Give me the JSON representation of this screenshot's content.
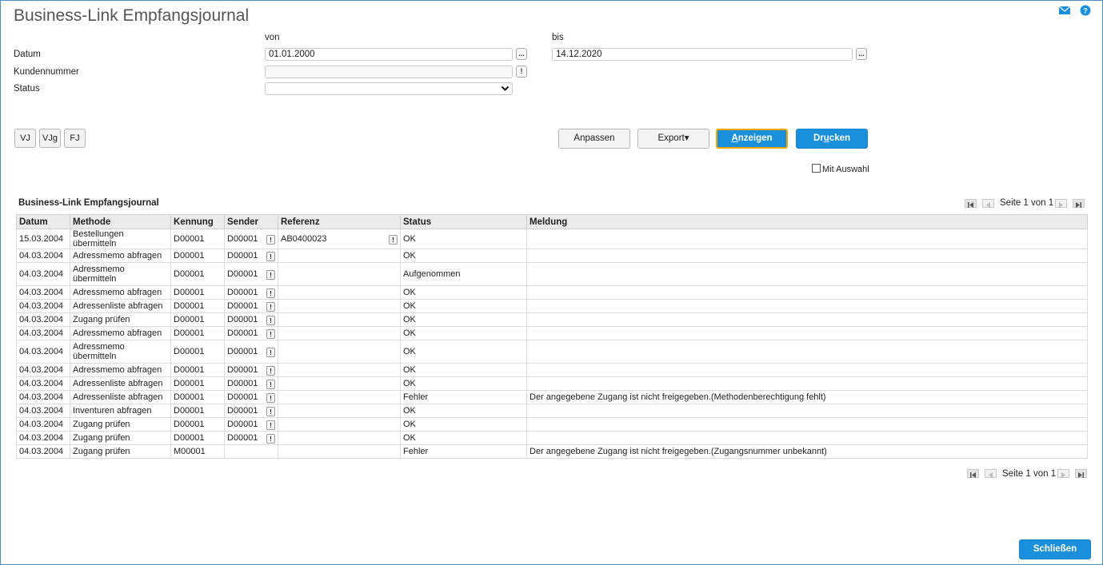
{
  "app": {
    "title": "Business-Link Empfangsjournal"
  },
  "icons": {
    "mail": "mail-icon",
    "help": "help-icon"
  },
  "filter": {
    "von_label": "von",
    "bis_label": "bis",
    "datum_label": "Datum",
    "kundennummer_label": "Kundennummer",
    "status_label": "Status",
    "datum_von": "01.01.2000",
    "datum_bis": "14.12.2020",
    "kundennummer": "",
    "status": "",
    "ellipsis": "...",
    "lookup": "!"
  },
  "quick": [
    "VJ",
    "VJg",
    "FJ"
  ],
  "actions": {
    "anpassen": "Anpassen",
    "export": "Export▾",
    "anzeigen_u": "A",
    "anzeigen_rest": "nzeigen",
    "drucken_a": "Dr",
    "drucken_u": "u",
    "drucken_b": "cken",
    "mit_auswahl": "Mit Auswahl"
  },
  "section_title": "Business-Link Empfangsjournal",
  "pager": {
    "text": "Seite 1 von 1"
  },
  "columns": [
    "Datum",
    "Methode",
    "Kennung",
    "Sender",
    "Referenz",
    "Status",
    "Meldung"
  ],
  "rows": [
    {
      "datum": "15.03.2004",
      "methode": "Bestellungen übermitteln",
      "kennung": "D00001",
      "sender": "D00001",
      "referenz": "AB0400023",
      "status": "OK",
      "meldung": ""
    },
    {
      "datum": "04.03.2004",
      "methode": "Adressmemo abfragen",
      "kennung": "D00001",
      "sender": "D00001",
      "referenz": "",
      "status": "OK",
      "meldung": ""
    },
    {
      "datum": "04.03.2004",
      "methode": "Adressmemo übermitteln",
      "kennung": "D00001",
      "sender": "D00001",
      "referenz": "",
      "status": "Aufgenommen",
      "meldung": ""
    },
    {
      "datum": "04.03.2004",
      "methode": "Adressmemo abfragen",
      "kennung": "D00001",
      "sender": "D00001",
      "referenz": "",
      "status": "OK",
      "meldung": ""
    },
    {
      "datum": "04.03.2004",
      "methode": "Adressenliste abfragen",
      "kennung": "D00001",
      "sender": "D00001",
      "referenz": "",
      "status": "OK",
      "meldung": ""
    },
    {
      "datum": "04.03.2004",
      "methode": "Zugang prüfen",
      "kennung": "D00001",
      "sender": "D00001",
      "referenz": "",
      "status": "OK",
      "meldung": ""
    },
    {
      "datum": "04.03.2004",
      "methode": "Adressmemo abfragen",
      "kennung": "D00001",
      "sender": "D00001",
      "referenz": "",
      "status": "OK",
      "meldung": ""
    },
    {
      "datum": "04.03.2004",
      "methode": "Adressmemo übermitteln",
      "kennung": "D00001",
      "sender": "D00001",
      "referenz": "",
      "status": "OK",
      "meldung": ""
    },
    {
      "datum": "04.03.2004",
      "methode": "Adressmemo abfragen",
      "kennung": "D00001",
      "sender": "D00001",
      "referenz": "",
      "status": "OK",
      "meldung": ""
    },
    {
      "datum": "04.03.2004",
      "methode": "Adressenliste abfragen",
      "kennung": "D00001",
      "sender": "D00001",
      "referenz": "",
      "status": "OK",
      "meldung": ""
    },
    {
      "datum": "04.03.2004",
      "methode": "Adressenliste abfragen",
      "kennung": "D00001",
      "sender": "D00001",
      "referenz": "",
      "status": "Fehler",
      "meldung": "Der angegebene Zugang ist nicht freigegeben.(Methodenberechtigung fehlt)"
    },
    {
      "datum": "04.03.2004",
      "methode": "Inventuren abfragen",
      "kennung": "D00001",
      "sender": "D00001",
      "referenz": "",
      "status": "OK",
      "meldung": ""
    },
    {
      "datum": "04.03.2004",
      "methode": "Zugang prüfen",
      "kennung": "D00001",
      "sender": "D00001",
      "referenz": "",
      "status": "OK",
      "meldung": ""
    },
    {
      "datum": "04.03.2004",
      "methode": "Zugang prüfen",
      "kennung": "D00001",
      "sender": "D00001",
      "referenz": "",
      "status": "OK",
      "meldung": ""
    },
    {
      "datum": "04.03.2004",
      "methode": "Zugang prüfen",
      "kennung": "M00001",
      "sender": "",
      "referenz": "",
      "status": "Fehler",
      "meldung": "Der angegebene Zugang ist nicht freigegeben.(Zugangsnummer unbekannt)"
    }
  ],
  "close_label": "Schließen"
}
